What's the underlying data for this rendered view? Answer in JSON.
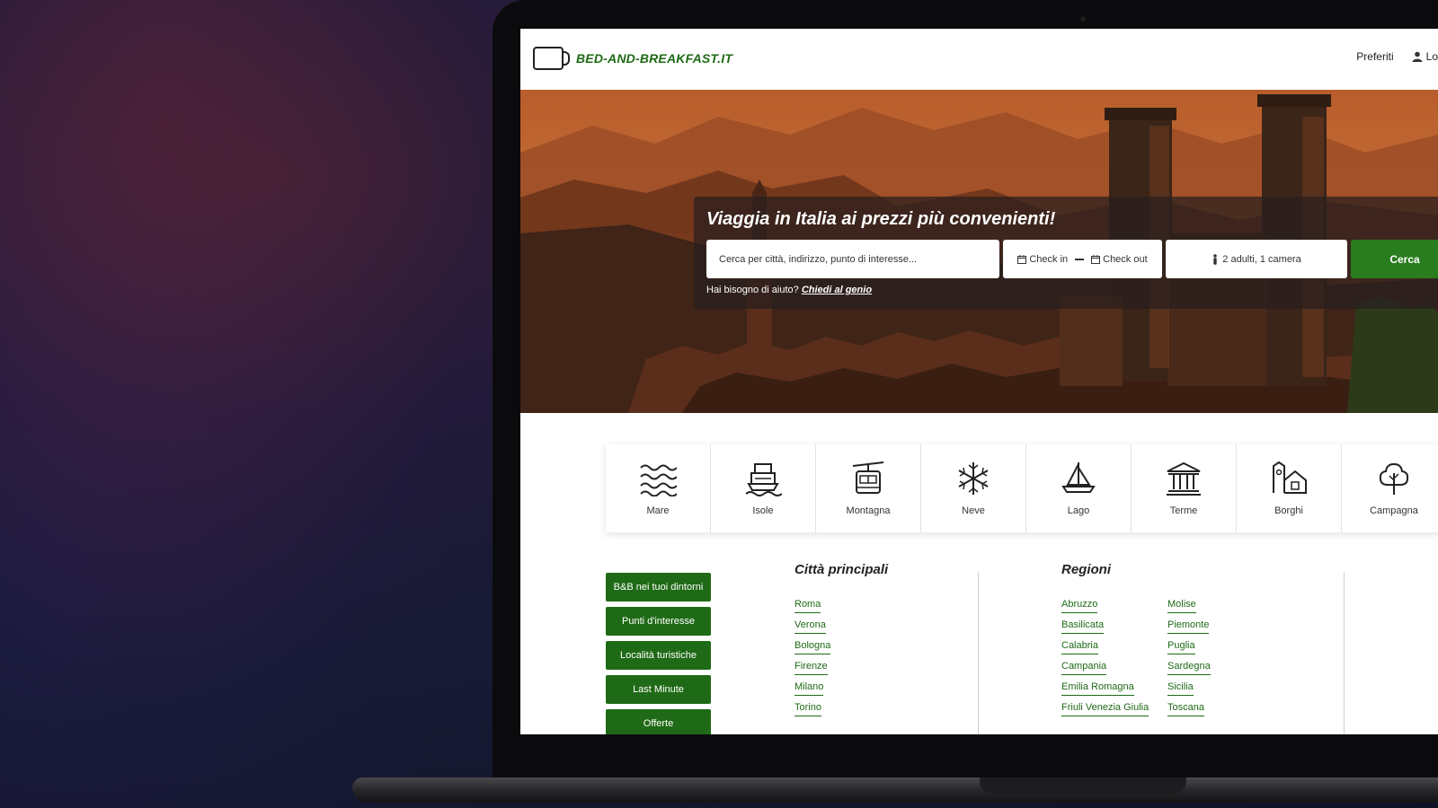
{
  "header": {
    "logo_text": "BED-AND-BREAKFAST.IT",
    "favorites": "Preferiti",
    "login": "Lo"
  },
  "hero": {
    "title": "Viaggia in Italia ai prezzi più convenienti!",
    "destination_placeholder": "Cerca per città, indirizzo, punto di interesse...",
    "check_in": "Check in",
    "check_out": "Check out",
    "guests": "2 adulti, 1 camera",
    "search_button": "Cerca",
    "help_text": "Hai bisogno di aiuto?",
    "help_link": "Chiedi al genio"
  },
  "categories": [
    {
      "label": "Mare",
      "icon": "waves-icon"
    },
    {
      "label": "Isole",
      "icon": "ferry-icon"
    },
    {
      "label": "Montagna",
      "icon": "cable-car-icon"
    },
    {
      "label": "Neve",
      "icon": "snowflake-icon"
    },
    {
      "label": "Lago",
      "icon": "sailboat-icon"
    },
    {
      "label": "Terme",
      "icon": "temple-icon"
    },
    {
      "label": "Borghi",
      "icon": "village-icon"
    },
    {
      "label": "Campagna",
      "icon": "tree-icon"
    }
  ],
  "side_buttons": [
    "B&B nei tuoi dintorni",
    "Punti d'interesse",
    "Località turistiche",
    "Last Minute",
    "Offerte"
  ],
  "cities": {
    "title": "Città principali",
    "items": [
      "Roma",
      "Verona",
      "Bologna",
      "Firenze",
      "Milano",
      "Torino"
    ]
  },
  "regions": {
    "title": "Regioni",
    "col1": [
      "Abruzzo",
      "Basilicata",
      "Calabria",
      "Campania",
      "Emilia Romagna",
      "Friuli Venezia Giulia"
    ],
    "col2": [
      "Molise",
      "Piemonte",
      "Puglia",
      "Sardegna",
      "Sicilia",
      "Toscana"
    ]
  },
  "colors": {
    "brand_green": "#1f6a16",
    "search_green": "#2a7d1e"
  }
}
